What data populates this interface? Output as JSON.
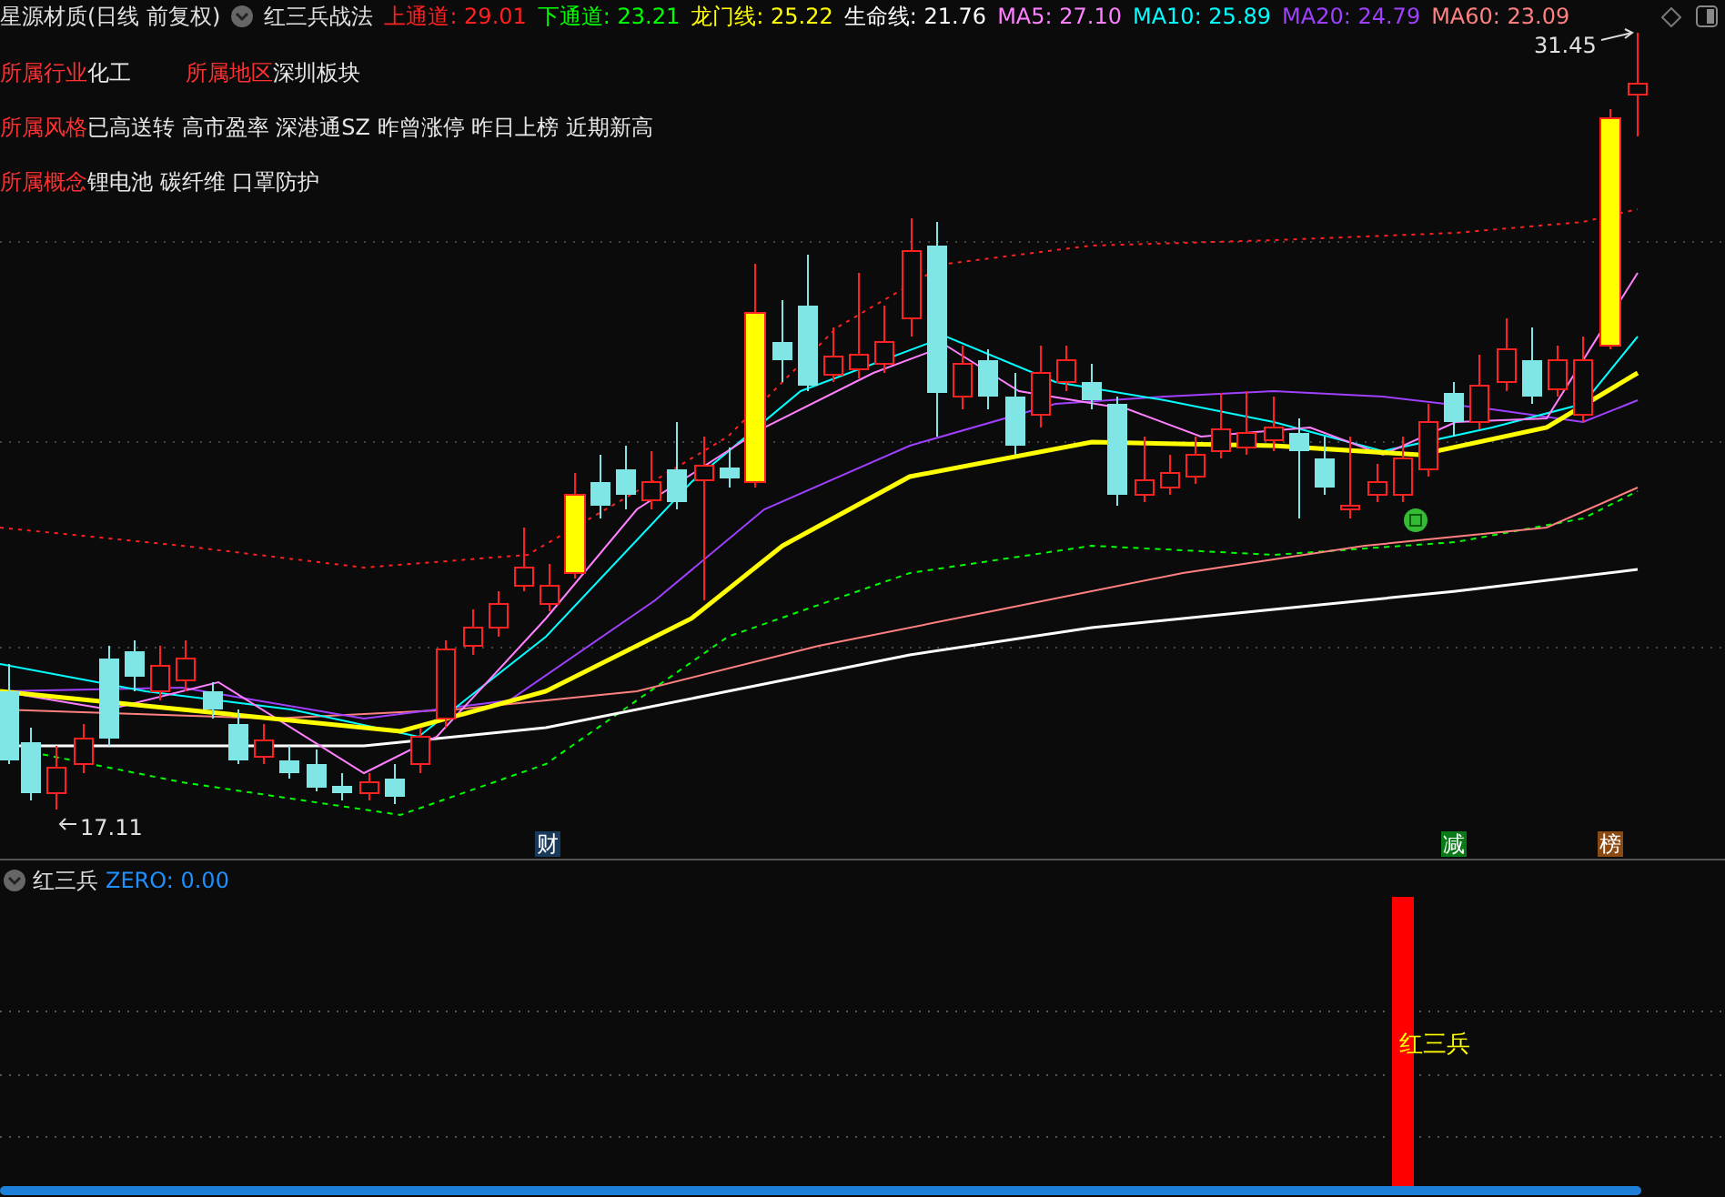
{
  "header": {
    "stock": "星源材质(日线 前复权)",
    "strategy": "红三兵战法",
    "indicators": [
      {
        "text": "上通道: 29.01",
        "color": "#ff2020"
      },
      {
        "text": "下通道: 23.21",
        "color": "#00ff00"
      },
      {
        "text": "龙门线: 25.22",
        "color": "#ffff00"
      },
      {
        "text": "生命线: 21.76",
        "color": "#ffffff"
      },
      {
        "text": "MA5: 27.10",
        "color": "#ff80ff"
      },
      {
        "text": "MA10: 25.89",
        "color": "#00ffff"
      },
      {
        "text": "MA20: 24.79",
        "color": "#a040ff"
      },
      {
        "text": "MA60: 23.09",
        "color": "#ff8080"
      }
    ]
  },
  "info_rows": [
    [
      {
        "label": "所属行业",
        "value": "化工"
      },
      {
        "label": "所属地区",
        "value": "深圳板块"
      }
    ],
    [
      {
        "label": "所属风格",
        "value": "已高送转 高市盈率 深港通SZ 昨曾涨停 昨日上榜 近期新高"
      }
    ],
    [
      {
        "label": "所属概念",
        "value": "锂电池 碳纤维 口罩防护"
      }
    ]
  ],
  "chart": {
    "high_label": "31.45",
    "low_label": "17.11",
    "markers": [
      {
        "text": "财",
        "color": "#1a3a5c"
      },
      {
        "text": "减",
        "color": "#0a7a18"
      },
      {
        "text": "榜",
        "color": "#8a4a12"
      }
    ]
  },
  "sub_panel": {
    "title": "红三兵",
    "zero": "ZERO: 0.00",
    "signal_label": "红三兵"
  }
}
